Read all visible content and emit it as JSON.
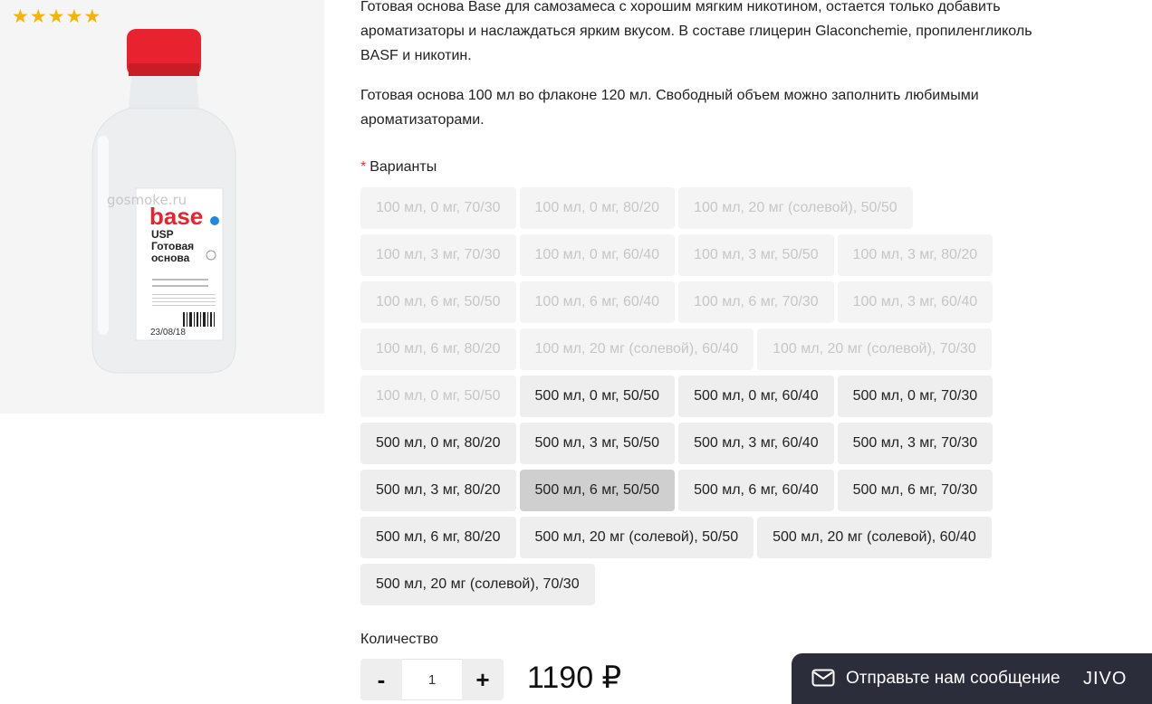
{
  "product": {
    "rating_stars": 5,
    "image_label": {
      "watermark": "gosmoke.ru",
      "brand": "base",
      "line1": "USP",
      "line2": "Готовая",
      "line3": "основа",
      "date": "23/08/18"
    }
  },
  "description": {
    "paragraph1": "Готовая основа Base для самозамеса с хорошим мягким никотином, остается только добавить ароматизаторы и наслаждаться ярким вкусом. В составе глицерин Glaconchemie, пропиленгликоль BASF и никотин.",
    "paragraph2": "Готовая основа 100 мл во флаконе 120 мл. Свободный объем можно заполнить любимыми ароматизаторами."
  },
  "variants": {
    "required_mark": "*",
    "label": "Варианты",
    "options": [
      {
        "label": "100 мл, 0 мг, 70/30",
        "state": "disabled"
      },
      {
        "label": "100 мл, 0 мг, 80/20",
        "state": "disabled"
      },
      {
        "label": "100 мл, 20 мг (солевой), 50/50",
        "state": "disabled"
      },
      {
        "label": "100 мл, 3 мг, 70/30",
        "state": "disabled"
      },
      {
        "label": "100 мл, 0 мг, 60/40",
        "state": "disabled"
      },
      {
        "label": "100 мл, 3 мг, 50/50",
        "state": "disabled"
      },
      {
        "label": "100 мл, 3 мг, 80/20",
        "state": "disabled"
      },
      {
        "label": "100 мл, 6 мг, 50/50",
        "state": "disabled"
      },
      {
        "label": "100 мл, 6 мг, 60/40",
        "state": "disabled"
      },
      {
        "label": "100 мл, 6 мг, 70/30",
        "state": "disabled"
      },
      {
        "label": "100 мл, 3 мг, 60/40",
        "state": "disabled"
      },
      {
        "label": "100 мл, 6 мг, 80/20",
        "state": "disabled"
      },
      {
        "label": "100 мл, 20 мг (солевой), 60/40",
        "state": "disabled"
      },
      {
        "label": "100 мл, 20 мг (солевой), 70/30",
        "state": "disabled"
      },
      {
        "label": "100 мл, 0 мг, 50/50",
        "state": "disabled"
      },
      {
        "label": "500 мл, 0 мг, 50/50",
        "state": "available"
      },
      {
        "label": "500 мл, 0 мг, 60/40",
        "state": "available"
      },
      {
        "label": "500 мл, 0 мг, 70/30",
        "state": "available"
      },
      {
        "label": "500 мл, 0 мг, 80/20",
        "state": "available"
      },
      {
        "label": "500 мл, 3 мг, 50/50",
        "state": "available"
      },
      {
        "label": "500 мл, 3 мг, 60/40",
        "state": "available"
      },
      {
        "label": "500 мл, 3 мг, 70/30",
        "state": "available"
      },
      {
        "label": "500 мл, 3 мг, 80/20",
        "state": "available"
      },
      {
        "label": "500 мл, 6 мг, 50/50",
        "state": "selected"
      },
      {
        "label": "500 мл, 6 мг, 60/40",
        "state": "available"
      },
      {
        "label": "500 мл, 6 мг, 70/30",
        "state": "available"
      },
      {
        "label": "500 мл, 6 мг, 80/20",
        "state": "available"
      },
      {
        "label": "500 мл, 20 мг (солевой), 50/50",
        "state": "available"
      },
      {
        "label": "500 мл, 20 мг (солевой), 60/40",
        "state": "available"
      },
      {
        "label": "500 мл, 20 мг (солевой), 70/30",
        "state": "available"
      }
    ]
  },
  "quantity": {
    "label": "Количество",
    "minus": "-",
    "plus": "+",
    "value": "1"
  },
  "price": "1190 ₽",
  "chat": {
    "text": "Отправьте нам сообщение",
    "brand": "JIVO"
  },
  "colors": {
    "star": "#f4b400",
    "cap": "#e8232f",
    "chat_bg": "#2b2d3a",
    "required": "#e53935"
  }
}
